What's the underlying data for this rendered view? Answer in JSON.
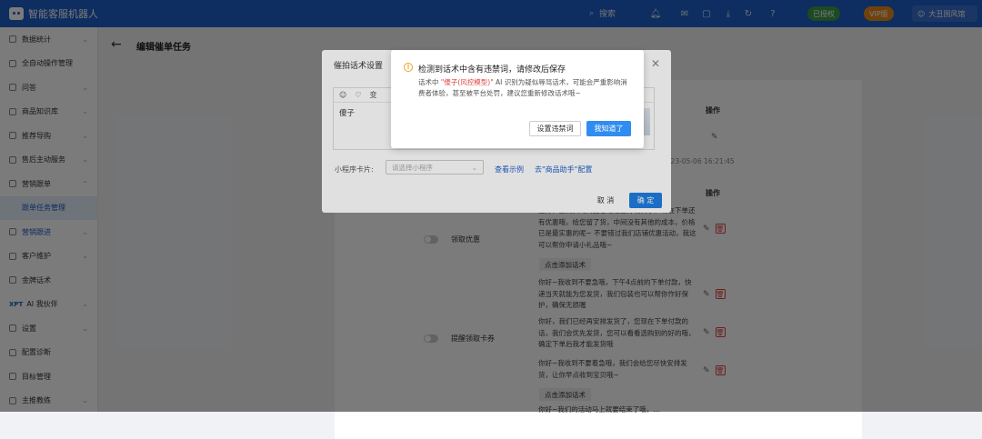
{
  "app": {
    "title": "智能客服机器人"
  },
  "topbar": {
    "search_label": "搜索",
    "status_green": "已授权",
    "status_orange": "VIP版",
    "user_label": "大丑国风馆"
  },
  "sidebar": {
    "items": [
      {
        "label": "数据统计"
      },
      {
        "label": "全自动操作管理"
      },
      {
        "label": "问答"
      },
      {
        "label": "商品知识库"
      },
      {
        "label": "推荐导购"
      },
      {
        "label": "售后主动服务"
      },
      {
        "label": "营销跟单"
      },
      {
        "label": "跟单任务管理"
      },
      {
        "label": "营销跟进"
      },
      {
        "label": "客户维护"
      },
      {
        "label": "金牌话术"
      },
      {
        "label": "AI 我伙伴",
        "prefix": "XPT"
      },
      {
        "label": "设置"
      },
      {
        "label": "配置诊断"
      },
      {
        "label": "目标管理"
      },
      {
        "label": "主推教练"
      }
    ]
  },
  "page": {
    "title": "编辑催单任务"
  },
  "panel": {
    "action_header_1": "操作",
    "action_header_2": "操作",
    "timestamp": "2023-05-06 16:21:45",
    "mode_1": "领取优惠",
    "mode_2": "提醒领取卡券",
    "scripts": [
      "您好，您购买的商品已经准备好发货了，现在下单还有优惠哦，给您留了货，中间没有其他的成本，价格已是最实惠的呢~ 不要错过我们店铺优惠活动，我这可以帮你申请小礼品哦~",
      "点击添加话术",
      "你好~我收到不要急哦，下午4点前的下单付款，快递当天就能为您发货，我们包装也可以帮你作好保护，确保无损喔",
      "你好，我们已经再安排发货了，您现在下单付款的话，我们会优先发货，您可以看看选购别的好的哦，确定下单后我才能发货哦",
      "你好~我收到不要着急哦，我们会给您尽快安排发货，让你早点收到宝贝哦~",
      "点击添加话术",
      "你好~我们的活动马上就要结束了哦，..."
    ]
  },
  "dialog1": {
    "title": "催拍话术设置",
    "editor_text": "傻子",
    "toolbar_partial": "变",
    "mini_label": "小程序卡片:",
    "mini_placeholder": "请选择小程序",
    "link_example": "查看示例",
    "link_config": "去\"商品助手\"配置",
    "cancel": "取 消",
    "ok": "确 定"
  },
  "alert": {
    "title": "检测到话术中含有违禁词，请修改后保存",
    "body_prefix": "话术中 ",
    "body_word": "\"傻子(风控模型)\"",
    "body_suffix": " AI 识别为疑似辱骂话术，可能会严重影响消费者体验，甚至被平台处罚，建议您重新修改话术哦~",
    "btn_settings": "设置违禁词",
    "btn_ok": "我知道了"
  }
}
